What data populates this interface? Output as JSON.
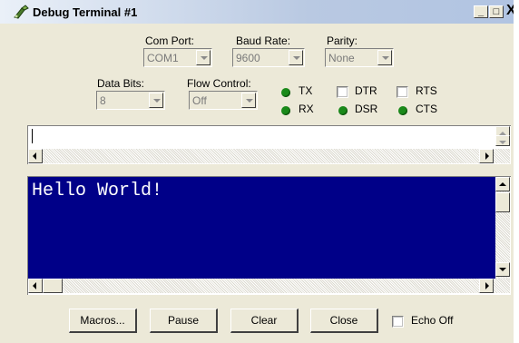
{
  "window": {
    "title": "Debug Terminal #1",
    "icon": "debug-terminal-icon",
    "controls": {
      "minimize": "_",
      "maximize": "□",
      "close": "X"
    }
  },
  "settings": {
    "com_port": {
      "label": "Com Port:",
      "value": "COM1"
    },
    "baud_rate": {
      "label": "Baud Rate:",
      "value": "9600"
    },
    "parity": {
      "label": "Parity:",
      "value": "None"
    },
    "data_bits": {
      "label": "Data Bits:",
      "value": "8"
    },
    "flow_control": {
      "label": "Flow Control:",
      "value": "Off"
    }
  },
  "indicators": {
    "tx": "TX",
    "rx": "RX",
    "dsr": "DSR",
    "cts": "CTS",
    "led_color": "#1a8a1a"
  },
  "toggles": {
    "dtr": {
      "label": "DTR",
      "checked": false
    },
    "rts": {
      "label": "RTS",
      "checked": false
    }
  },
  "transmit": {
    "value": ""
  },
  "receive": {
    "text": "Hello World!",
    "background": "#000088",
    "color": "#ffffff"
  },
  "buttons": {
    "macros": "Macros...",
    "pause": "Pause",
    "clear": "Clear",
    "close": "Close"
  },
  "echo_off": {
    "label": "Echo Off",
    "checked": false
  }
}
